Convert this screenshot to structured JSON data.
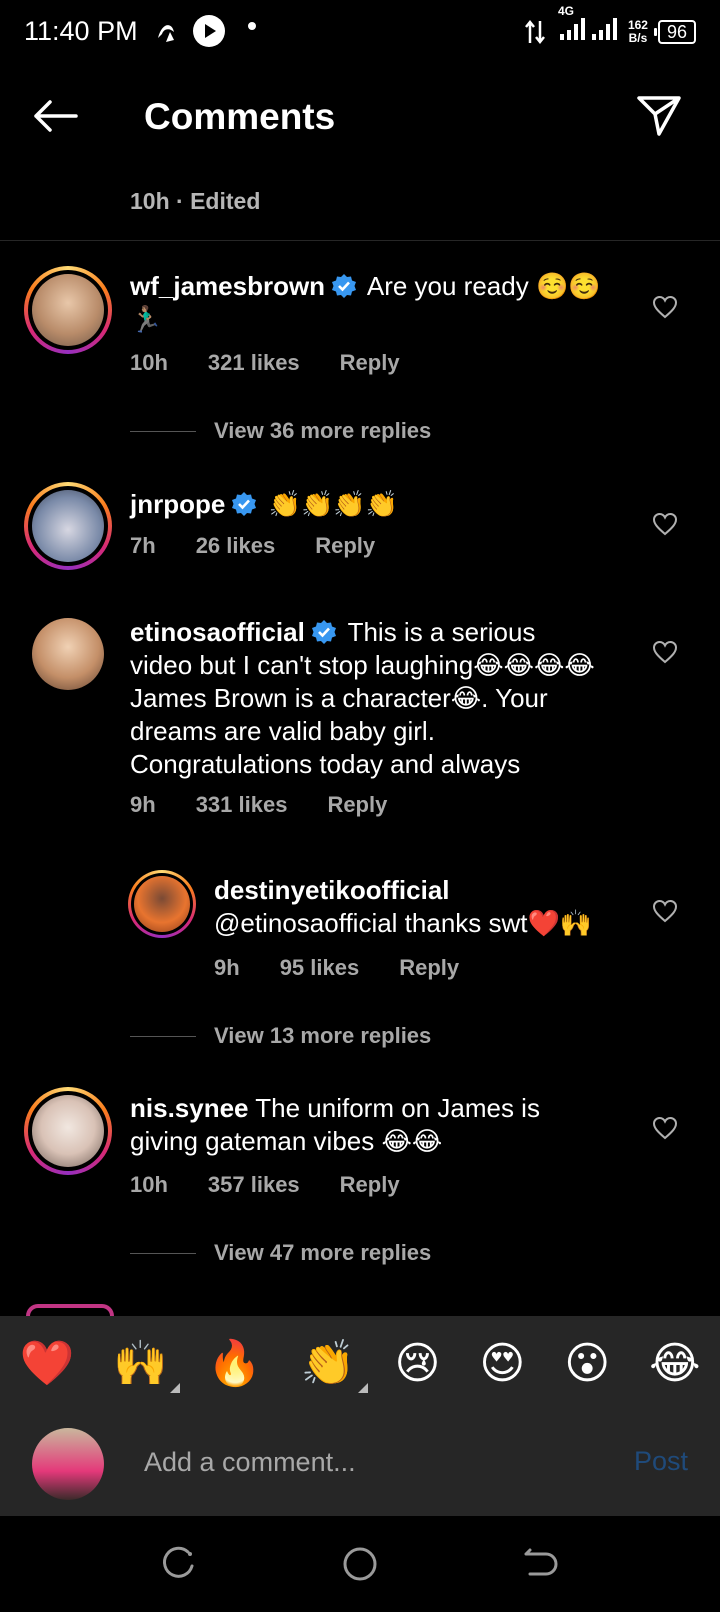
{
  "status_bar": {
    "time": "11:40 PM",
    "network": "4G",
    "speed_value": "162",
    "speed_unit": "B/s",
    "battery": "96"
  },
  "header": {
    "title": "Comments"
  },
  "post_meta": {
    "time": "10h",
    "separator": "·",
    "edited": "Edited"
  },
  "comments": [
    {
      "username": "wf_jamesbrown",
      "verified": true,
      "text": "Are you ready ☺️☺️🏃🏽‍♂️",
      "time": "10h",
      "likes": "321 likes",
      "reply": "Reply",
      "view_more": "View 36 more replies"
    },
    {
      "username": "jnrpope",
      "verified": true,
      "text": "👏👏👏👏",
      "time": "7h",
      "likes": "26 likes",
      "reply": "Reply"
    },
    {
      "username": "etinosaofficial",
      "verified": true,
      "text": "This is a serious video but I can't stop laughing😂😂😂😂 James Brown is a character😂. Your dreams are valid baby girl. Congratulations today and always",
      "time": "9h",
      "likes": "331 likes",
      "reply": "Reply"
    },
    {
      "username": "destinyetikoofficial",
      "text": "@etinosaofficial thanks swt❤️🙌",
      "time": "9h",
      "likes": "95 likes",
      "reply": "Reply",
      "view_more": "View 13 more replies"
    },
    {
      "username": "nis.synee",
      "text": "The uniform on James is giving gateman vibes 😂😂",
      "time": "10h",
      "likes": "357 likes",
      "reply": "Reply",
      "view_more": "View 47 more replies"
    }
  ],
  "emoji_bar": [
    "❤️",
    "🙌",
    "🔥",
    "👏",
    "😢",
    "😍",
    "😮",
    "😂"
  ],
  "composer": {
    "placeholder": "Add a comment...",
    "post_label": "Post"
  },
  "colors": {
    "background": "#000000",
    "verified_blue": "#3897f0",
    "post_disabled": "#1f4a7a",
    "secondary_text": "#a8a8a8"
  }
}
